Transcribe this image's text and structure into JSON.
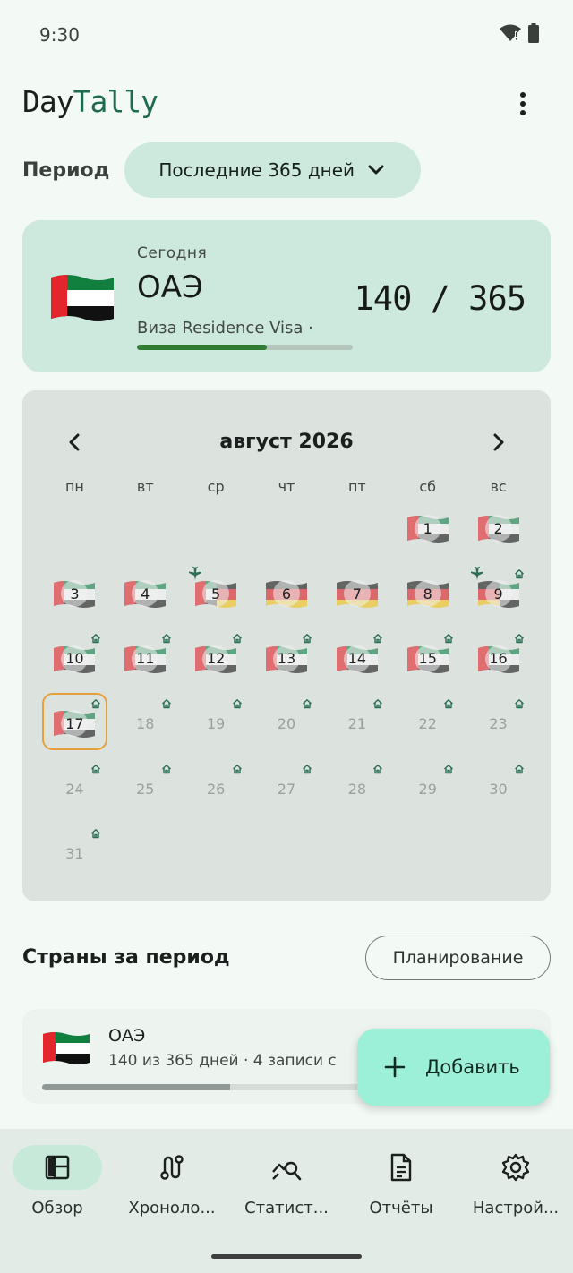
{
  "status_bar": {
    "time": "9:30"
  },
  "app": {
    "title_part1": "Day",
    "title_part2": "Tally"
  },
  "period": {
    "label": "Период",
    "selected": "Последние 365 дней"
  },
  "today": {
    "label": "Сегодня",
    "country": "ОАЭ",
    "visa": "Виза Residence Visa ·",
    "count": "140 / 365",
    "progress": 0.6
  },
  "calendar": {
    "month": "август 2026",
    "weekdays": [
      "пн",
      "вт",
      "ср",
      "чт",
      "пт",
      "сб",
      "вс"
    ],
    "days": [
      {
        "d": "",
        "flag": "none"
      },
      {
        "d": "",
        "flag": "none"
      },
      {
        "d": "",
        "flag": "none"
      },
      {
        "d": "",
        "flag": "none"
      },
      {
        "d": "",
        "flag": "none"
      },
      {
        "d": "1",
        "flag": "uae"
      },
      {
        "d": "2",
        "flag": "uae"
      },
      {
        "d": "3",
        "flag": "uae"
      },
      {
        "d": "4",
        "flag": "uae"
      },
      {
        "d": "5",
        "flag": "uae-de",
        "plane": true
      },
      {
        "d": "6",
        "flag": "de"
      },
      {
        "d": "7",
        "flag": "de"
      },
      {
        "d": "8",
        "flag": "de"
      },
      {
        "d": "9",
        "flag": "de-uae",
        "plane": true,
        "house": true
      },
      {
        "d": "10",
        "flag": "uae",
        "house": true
      },
      {
        "d": "11",
        "flag": "uae",
        "house": true
      },
      {
        "d": "12",
        "flag": "uae",
        "house": true
      },
      {
        "d": "13",
        "flag": "uae",
        "house": true
      },
      {
        "d": "14",
        "flag": "uae",
        "house": true
      },
      {
        "d": "15",
        "flag": "uae",
        "house": true
      },
      {
        "d": "16",
        "flag": "uae",
        "house": true
      },
      {
        "d": "17",
        "flag": "uae",
        "house": true,
        "today": true
      },
      {
        "d": "18",
        "flag": "future",
        "house": true
      },
      {
        "d": "19",
        "flag": "future",
        "house": true
      },
      {
        "d": "20",
        "flag": "future",
        "house": true
      },
      {
        "d": "21",
        "flag": "future",
        "house": true
      },
      {
        "d": "22",
        "flag": "future",
        "house": true
      },
      {
        "d": "23",
        "flag": "future",
        "house": true
      },
      {
        "d": "24",
        "flag": "future",
        "house": true
      },
      {
        "d": "25",
        "flag": "future",
        "house": true
      },
      {
        "d": "26",
        "flag": "future",
        "house": true
      },
      {
        "d": "27",
        "flag": "future",
        "house": true
      },
      {
        "d": "28",
        "flag": "future",
        "house": true
      },
      {
        "d": "29",
        "flag": "future",
        "house": true
      },
      {
        "d": "30",
        "flag": "future",
        "house": true
      },
      {
        "d": "31",
        "flag": "future",
        "house": true
      }
    ]
  },
  "countries": {
    "title": "Страны за период",
    "plan_button": "Планирование",
    "items": [
      {
        "name": "ОАЭ",
        "meta": "140 из 365 дней  ·  4 записи с",
        "progress": 0.385
      }
    ]
  },
  "fab": {
    "label": "Добавить"
  },
  "nav": {
    "items": [
      {
        "label": "Обзор",
        "icon": "dashboard-icon",
        "active": true
      },
      {
        "label": "Хроноло...",
        "icon": "route-icon",
        "active": false
      },
      {
        "label": "Статист...",
        "icon": "chart-search-icon",
        "active": false
      },
      {
        "label": "Отчёты",
        "icon": "document-icon",
        "active": false
      },
      {
        "label": "Настрой...",
        "icon": "gear-icon",
        "active": false
      }
    ]
  },
  "colors": {
    "accent": "#1f6b4d",
    "chip": "#cde8dc",
    "fab": "#9df0d8",
    "today_ring": "#e5a03c"
  }
}
